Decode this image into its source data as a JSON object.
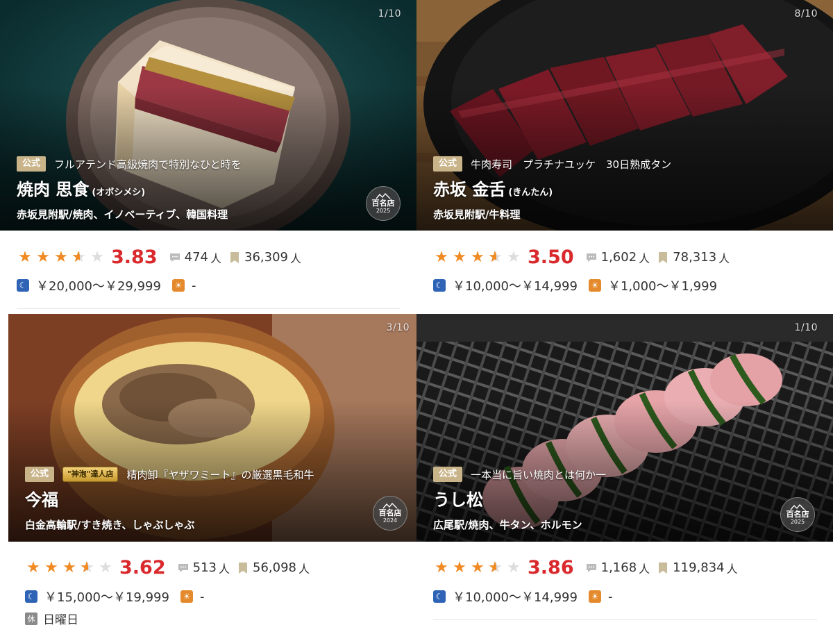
{
  "cards": [
    {
      "counter": "1/10",
      "official": "公式",
      "tagline": "フルアテンド高級焼肉で特別なひと時を",
      "name": "焼肉 思食",
      "reading": "(オボシメシ)",
      "genre": "赤坂見附駅/焼肉、イノベーティブ、韓国料理",
      "badge": {
        "title": "百名店",
        "year": "2025"
      },
      "rating": 3.83,
      "rating_text": "3.83",
      "reviews": "474",
      "bookmarks": "36,309",
      "unit": "人",
      "dinner_price": "￥20,000～￥29,999",
      "lunch_price": "-"
    },
    {
      "counter": "8/10",
      "official": "公式",
      "tagline": "牛肉寿司　プラチナユッケ　30日熟成タン",
      "name": "赤坂 金舌",
      "reading": "(きんたん)",
      "genre": "赤坂見附駅/牛料理",
      "rating": 3.5,
      "rating_text": "3.50",
      "reviews": "1,602",
      "bookmarks": "78,313",
      "unit": "人",
      "dinner_price": "￥10,000～￥14,999",
      "lunch_price": "￥1,000～￥1,999"
    },
    {
      "counter": "3/10",
      "official": "公式",
      "gold_tag": "\"神泡\"達人店",
      "tagline": "精肉卸『ヤザワミート』の厳選黒毛和牛",
      "name": "今福",
      "genre": "白金高輪駅/すき焼き、しゃぶしゃぶ",
      "badge": {
        "title": "百名店",
        "year": "2024"
      },
      "rating": 3.62,
      "rating_text": "3.62",
      "reviews": "513",
      "bookmarks": "56,098",
      "unit": "人",
      "dinner_price": "￥15,000～￥19,999",
      "lunch_price": "-",
      "closed_icon": "休",
      "closed_day": "日曜日"
    },
    {
      "counter": "1/10",
      "official": "公式",
      "tagline": "一本当に旨い焼肉とは何か一",
      "name": "うし松",
      "genre": "広尾駅/焼肉、牛タン、ホルモン",
      "badge": {
        "title": "百名店",
        "year": "2025"
      },
      "rating": 3.86,
      "rating_text": "3.86",
      "reviews": "1,168",
      "bookmarks": "119,834",
      "unit": "人",
      "dinner_price": "￥10,000～￥14,999",
      "lunch_price": "-"
    }
  ],
  "colors": {
    "star": "#f08a24",
    "score": "#d9292c",
    "official_tag": "#c9b48a",
    "dinner_icon": "#2f63b6",
    "lunch_icon": "#e48a2c"
  },
  "icons": {
    "review": "speech-bubble-icon",
    "bookmark": "bookmark-icon",
    "dinner": "moon-icon",
    "lunch": "sun-icon",
    "closed": "closed-day-icon",
    "badge": "mountain-icon"
  }
}
